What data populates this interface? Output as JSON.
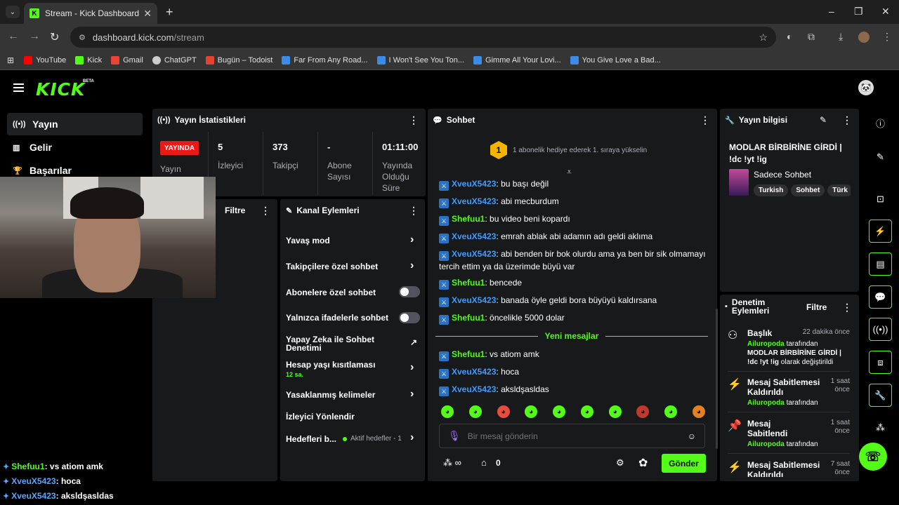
{
  "browser": {
    "tab_title": "Stream - Kick Dashboard",
    "url_host": "dashboard.kick.com",
    "url_path": "/stream",
    "bookmarks": [
      {
        "label": "YouTube",
        "color": "#ff0000"
      },
      {
        "label": "Kick",
        "color": "#53fc18"
      },
      {
        "label": "Gmail",
        "color": "#ea4335"
      },
      {
        "label": "ChatGPT",
        "color": "#cccccc"
      },
      {
        "label": "Bugün – Todoist",
        "color": "#e44332"
      },
      {
        "label": "Far From Any Road...",
        "color": "#3c8ce7"
      },
      {
        "label": "I Won't See You Ton...",
        "color": "#3c8ce7"
      },
      {
        "label": "Gimme All Your Lovi...",
        "color": "#3c8ce7"
      },
      {
        "label": "You Give Love a Bad...",
        "color": "#3c8ce7"
      }
    ]
  },
  "app": {
    "logo": "KICK",
    "beta": "BETA",
    "accent": "#53fc18"
  },
  "sidebar": {
    "items": [
      {
        "label": "Yayın",
        "icon": "broadcast-icon"
      },
      {
        "label": "Gelir",
        "icon": "chart-icon"
      },
      {
        "label": "Başarılar",
        "icon": "trophy-icon"
      }
    ]
  },
  "overlay_chat": [
    {
      "user": "Shefuu1",
      "text": "vs atiom amk"
    },
    {
      "user": "XveuX5423",
      "text": "hoca"
    },
    {
      "user": "XveuX5423",
      "text": "aksldşasldas"
    }
  ],
  "stats": {
    "title": "Yayın İstatistikleri",
    "live": "YAYINDA",
    "live_label": "Yayın",
    "items": [
      {
        "value": "5",
        "label": "İzleyici"
      },
      {
        "value": "373",
        "label": "Takipçi"
      },
      {
        "value": "-",
        "label": "Abone Sayısı"
      },
      {
        "value": "01:11:00",
        "label": "Yayında Olduğu Süre"
      }
    ]
  },
  "filter_panel": {
    "title": "Filtre"
  },
  "channel_actions": {
    "title": "Kanal Eylemleri",
    "items": [
      {
        "label": "Yavaş mod"
      },
      {
        "label": "Takipçilere özel sohbet"
      },
      {
        "label": "Abonelere özel sohbet"
      },
      {
        "label": "Yalnızca ifadelerle sohbet"
      },
      {
        "label": "Yapay Zeka ile Sohbet Denetimi"
      },
      {
        "label": "Hesap yaşı kısıtlaması",
        "sub": "12 sa."
      },
      {
        "label": "Yasaklanmış kelimeler"
      },
      {
        "label": "İzleyici Yönlendir"
      },
      {
        "label": "Hedefleri b...",
        "extra": "Aktif hedefler - 1"
      }
    ]
  },
  "chat": {
    "title": "Sohbet",
    "banner_rank": "1",
    "banner": "1 abonelik hediye ederek 1. sıraya yükselin",
    "messages": [
      {
        "user": "XveuX5423",
        "text": "bu başı değil"
      },
      {
        "user": "XveuX5423",
        "text": "abi mecburdum"
      },
      {
        "user": "Shefuu1",
        "text": "bu video beni kopardı"
      },
      {
        "user": "XveuX5423",
        "text": "emrah ablak abi adamın adı geldi aklıma"
      },
      {
        "user": "XveuX5423",
        "text": "abi benden bir bok olurdu ama ya ben bir sik olmamayı tercih ettim ya da üzerimde büyü var"
      },
      {
        "user": "Shefuu1",
        "text": "bencede"
      },
      {
        "user": "XveuX5423",
        "text": "banada öyle geldi bora büyüyü kaldırsana"
      },
      {
        "user": "Shefuu1",
        "text": "öncelikle 5000 dolar"
      }
    ],
    "new_label": "Yeni mesajlar",
    "new_messages": [
      {
        "user": "Shefuu1",
        "text": "vs atiom amk"
      },
      {
        "user": "XveuX5423",
        "text": "hoca"
      },
      {
        "user": "XveuX5423",
        "text": "aksldşasldas"
      }
    ],
    "placeholder": "Bir mesaj gönderin",
    "points": "0",
    "send": "Gönder"
  },
  "stream_info": {
    "title": "Yayın bilgisi",
    "stream_title": "MODLAR BİRBİRİNE GİRDİ | !dc !yt !ig",
    "category": "Sadece Sohbet",
    "tags": [
      "Turkish",
      "Sohbet",
      "Türk"
    ]
  },
  "moderation": {
    "title": "Denetim Eylemleri",
    "filter": "Filtre",
    "items": [
      {
        "action": "Başlık",
        "time": "22 dakika önce",
        "user": "Ailuropoda",
        "by": "tarafından",
        "detail": "MODLAR BİRBİRİNE GİRDİ | !dc !yt !ig",
        "suffix": "olarak değiştirildi"
      },
      {
        "action": "Mesaj Sabitlemesi Kaldırıldı",
        "time": "1 saat önce",
        "user": "Ailuropoda",
        "by": "tarafından"
      },
      {
        "action": "Mesaj Sabitlendi",
        "time": "1 saat önce",
        "user": "Ailuropoda",
        "by": "tarafından"
      },
      {
        "action": "Mesaj Sabitlemesi Kaldırıldı",
        "time": "7 saat önce"
      }
    ]
  }
}
